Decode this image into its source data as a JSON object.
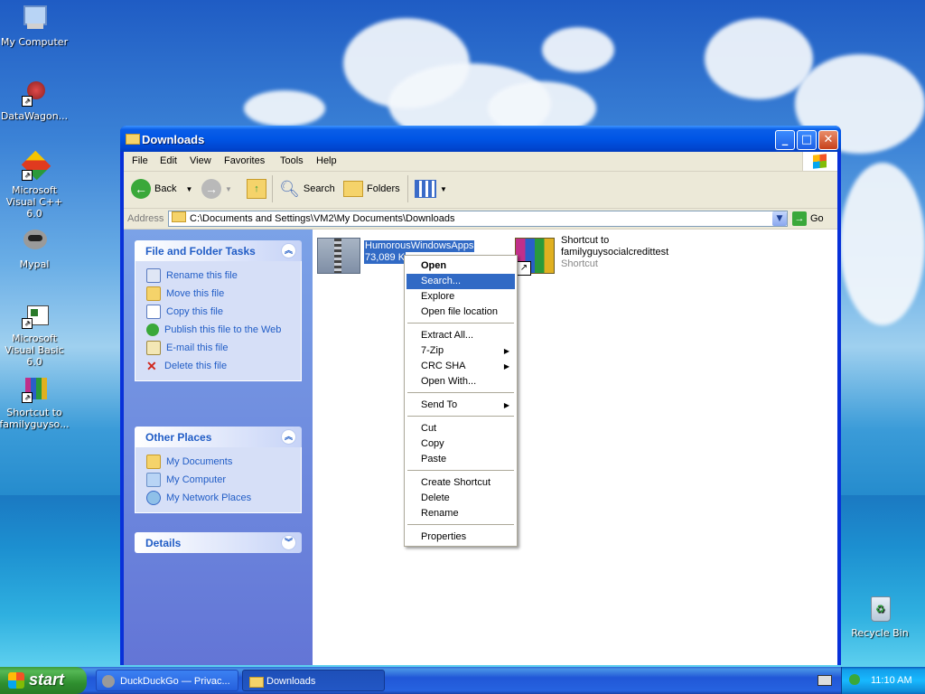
{
  "desktop": {
    "icons": [
      {
        "label": "My Computer"
      },
      {
        "label": "DataWagon..."
      },
      {
        "label": "Microsoft Visual C++ 6.0"
      },
      {
        "label": "Mypal"
      },
      {
        "label": "Microsoft Visual Basic 6.0"
      },
      {
        "label": "Shortcut to familyguyso..."
      },
      {
        "label": "Recycle Bin"
      }
    ]
  },
  "window": {
    "title": "Downloads",
    "menus": [
      "File",
      "Edit",
      "View",
      "Favorites",
      "Tools",
      "Help"
    ],
    "toolbar": {
      "back": "Back",
      "search": "Search",
      "folders": "Folders"
    },
    "address": {
      "label": "Address",
      "value": "C:\\Documents and Settings\\VM2\\My Documents\\Downloads",
      "go": "Go"
    },
    "tasks_panel": {
      "title": "File and Folder Tasks",
      "items": [
        "Rename this file",
        "Move this file",
        "Copy this file",
        "Publish this file to the Web",
        "E-mail this file",
        "Delete this file"
      ]
    },
    "places_panel": {
      "title": "Other Places",
      "items": [
        "My Documents",
        "My Computer",
        "My Network Places"
      ]
    },
    "details_panel": {
      "title": "Details"
    },
    "files": [
      {
        "name": "HumorousWindowsApps",
        "size": "73,089 K",
        "selected": true
      },
      {
        "name1": "Shortcut to",
        "name2": "familyguysocialcredittest",
        "type": "Shortcut"
      }
    ]
  },
  "context_menu": {
    "items": [
      "Open",
      "Search...",
      "Explore",
      "Open file location",
      "Extract All...",
      "7-Zip",
      "CRC SHA",
      "Open With...",
      "Send To",
      "Cut",
      "Copy",
      "Paste",
      "Create Shortcut",
      "Delete",
      "Rename",
      "Properties"
    ],
    "highlighted": "Search..."
  },
  "taskbar": {
    "start": "start",
    "buttons": [
      "DuckDuckGo — Privac...",
      "Downloads"
    ],
    "clock": "11:10 AM"
  },
  "colors": {
    "title_blue": "#0055e5",
    "link_blue": "#215dc6",
    "highlight": "#316ac5"
  }
}
